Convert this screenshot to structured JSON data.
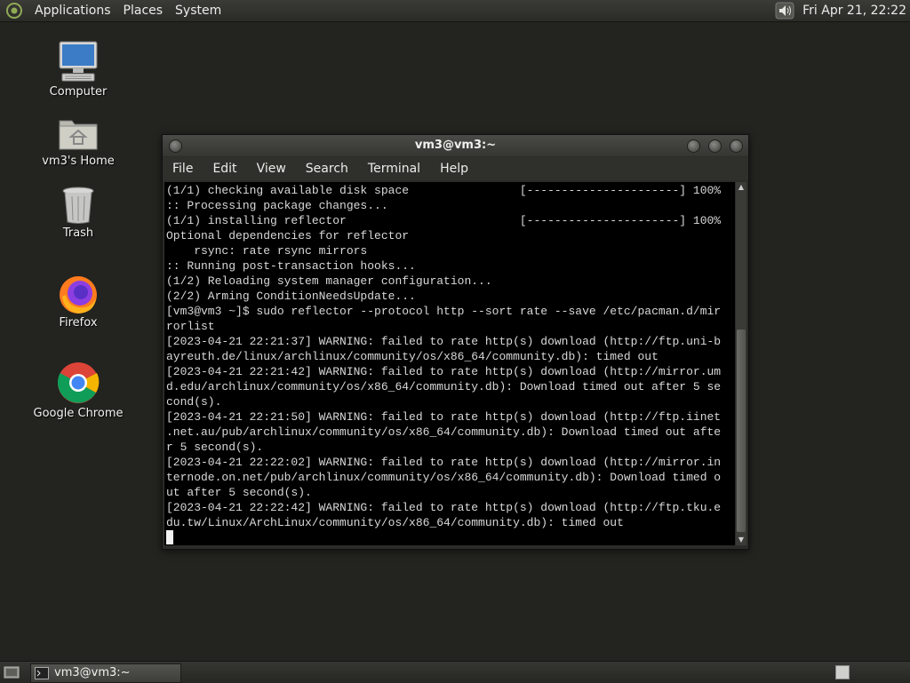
{
  "top_panel": {
    "menus": [
      "Applications",
      "Places",
      "System"
    ],
    "clock": "Fri Apr 21, 22:22"
  },
  "desktop_icons": [
    {
      "label": "Computer",
      "icon": "computer-icon"
    },
    {
      "label": "vm3's Home",
      "icon": "home-folder-icon"
    },
    {
      "label": "Trash",
      "icon": "trash-icon"
    },
    {
      "label": "Firefox",
      "icon": "firefox-icon"
    },
    {
      "label": "Google Chrome",
      "icon": "chrome-icon"
    }
  ],
  "terminal": {
    "title": "vm3@vm3:~",
    "menu": [
      "File",
      "Edit",
      "View",
      "Search",
      "Terminal",
      "Help"
    ],
    "lines": [
      "(1/1) checking available disk space                [----------------------] 100%",
      ":: Processing package changes...",
      "(1/1) installing reflector                         [----------------------] 100%",
      "Optional dependencies for reflector",
      "    rsync: rate rsync mirrors",
      ":: Running post-transaction hooks...",
      "(1/2) Reloading system manager configuration...",
      "(2/2) Arming ConditionNeedsUpdate...",
      "[vm3@vm3 ~]$ sudo reflector --protocol http --sort rate --save /etc/pacman.d/mir",
      "rorlist",
      "[2023-04-21 22:21:37] WARNING: failed to rate http(s) download (http://ftp.uni-b",
      "ayreuth.de/linux/archlinux/community/os/x86_64/community.db): timed out",
      "[2023-04-21 22:21:42] WARNING: failed to rate http(s) download (http://mirror.um",
      "d.edu/archlinux/community/os/x86_64/community.db): Download timed out after 5 se",
      "cond(s).",
      "[2023-04-21 22:21:50] WARNING: failed to rate http(s) download (http://ftp.iinet",
      ".net.au/pub/archlinux/community/os/x86_64/community.db): Download timed out afte",
      "r 5 second(s).",
      "[2023-04-21 22:22:02] WARNING: failed to rate http(s) download (http://mirror.in",
      "ternode.on.net/pub/archlinux/community/os/x86_64/community.db): Download timed o",
      "ut after 5 second(s).",
      "[2023-04-21 22:22:42] WARNING: failed to rate http(s) download (http://ftp.tku.e",
      "du.tw/Linux/ArchLinux/community/os/x86_64/community.db): timed out"
    ]
  },
  "taskbar": {
    "task_label": "vm3@vm3:~"
  }
}
